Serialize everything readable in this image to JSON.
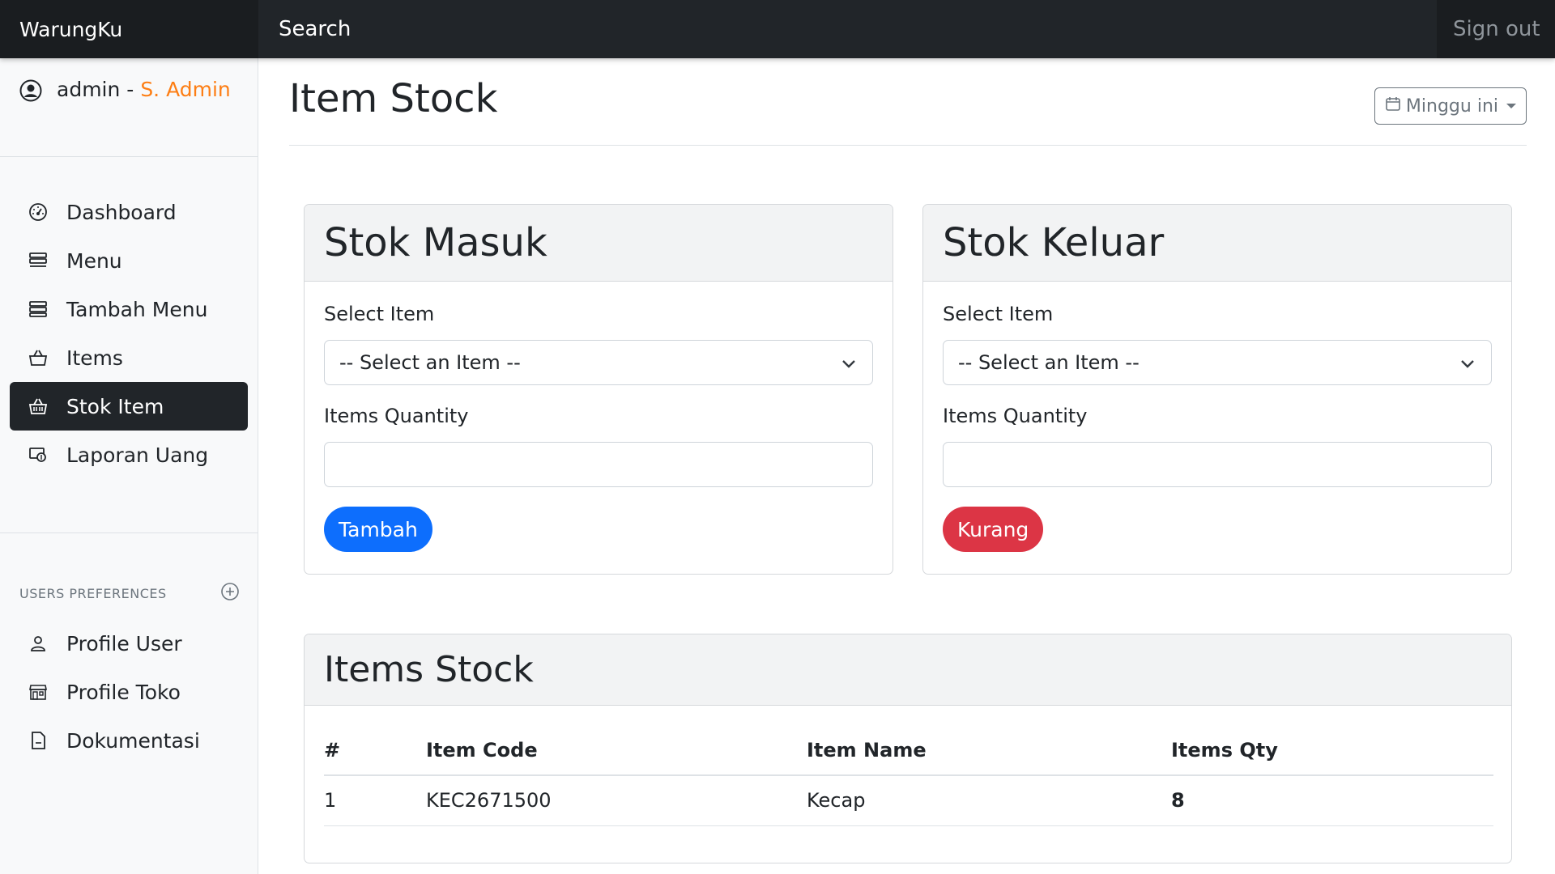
{
  "app": {
    "brand": "WarungKu",
    "search": "Search",
    "signout": "Sign out"
  },
  "user": {
    "name": "admin -",
    "role": "S. Admin"
  },
  "sidebar": {
    "items": [
      {
        "label": "Dashboard",
        "icon": "speedometer-icon",
        "active": false
      },
      {
        "label": "Menu",
        "icon": "stack-icon",
        "active": false
      },
      {
        "label": "Tambah Menu",
        "icon": "stack-add-icon",
        "active": false
      },
      {
        "label": "Items",
        "icon": "basket-icon",
        "active": false
      },
      {
        "label": "Stok Item",
        "icon": "basket-filled-icon",
        "active": true
      },
      {
        "label": "Laporan Uang",
        "icon": "money-icon",
        "active": false
      }
    ],
    "pref_heading": "USERS PREFERENCES",
    "pref_items": [
      {
        "label": "Profile User",
        "icon": "person-icon"
      },
      {
        "label": "Profile Toko",
        "icon": "shop-icon"
      },
      {
        "label": "Dokumentasi",
        "icon": "document-icon"
      }
    ]
  },
  "page": {
    "title": "Item Stock",
    "period": "Minggu ini"
  },
  "stok_masuk": {
    "title": "Stok Masuk",
    "select_label": "Select Item",
    "select_value": "-- Select an Item --",
    "qty_label": "Items Quantity",
    "qty_value": "",
    "button": "Tambah"
  },
  "stok_keluar": {
    "title": "Stok Keluar",
    "select_label": "Select Item",
    "select_value": "-- Select an Item --",
    "qty_label": "Items Quantity",
    "qty_value": "",
    "button": "Kurang"
  },
  "items_stock": {
    "title": "Items Stock",
    "columns": [
      "#",
      "Item Code",
      "Item Name",
      "Items Qty"
    ],
    "rows": [
      {
        "no": "1",
        "code": "KEC2671500",
        "name": "Kecap",
        "qty": "8"
      }
    ]
  },
  "colors": {
    "accent_orange": "#fd7e14",
    "primary": "#0d6efd",
    "danger": "#dc3545",
    "dark": "#212529"
  }
}
